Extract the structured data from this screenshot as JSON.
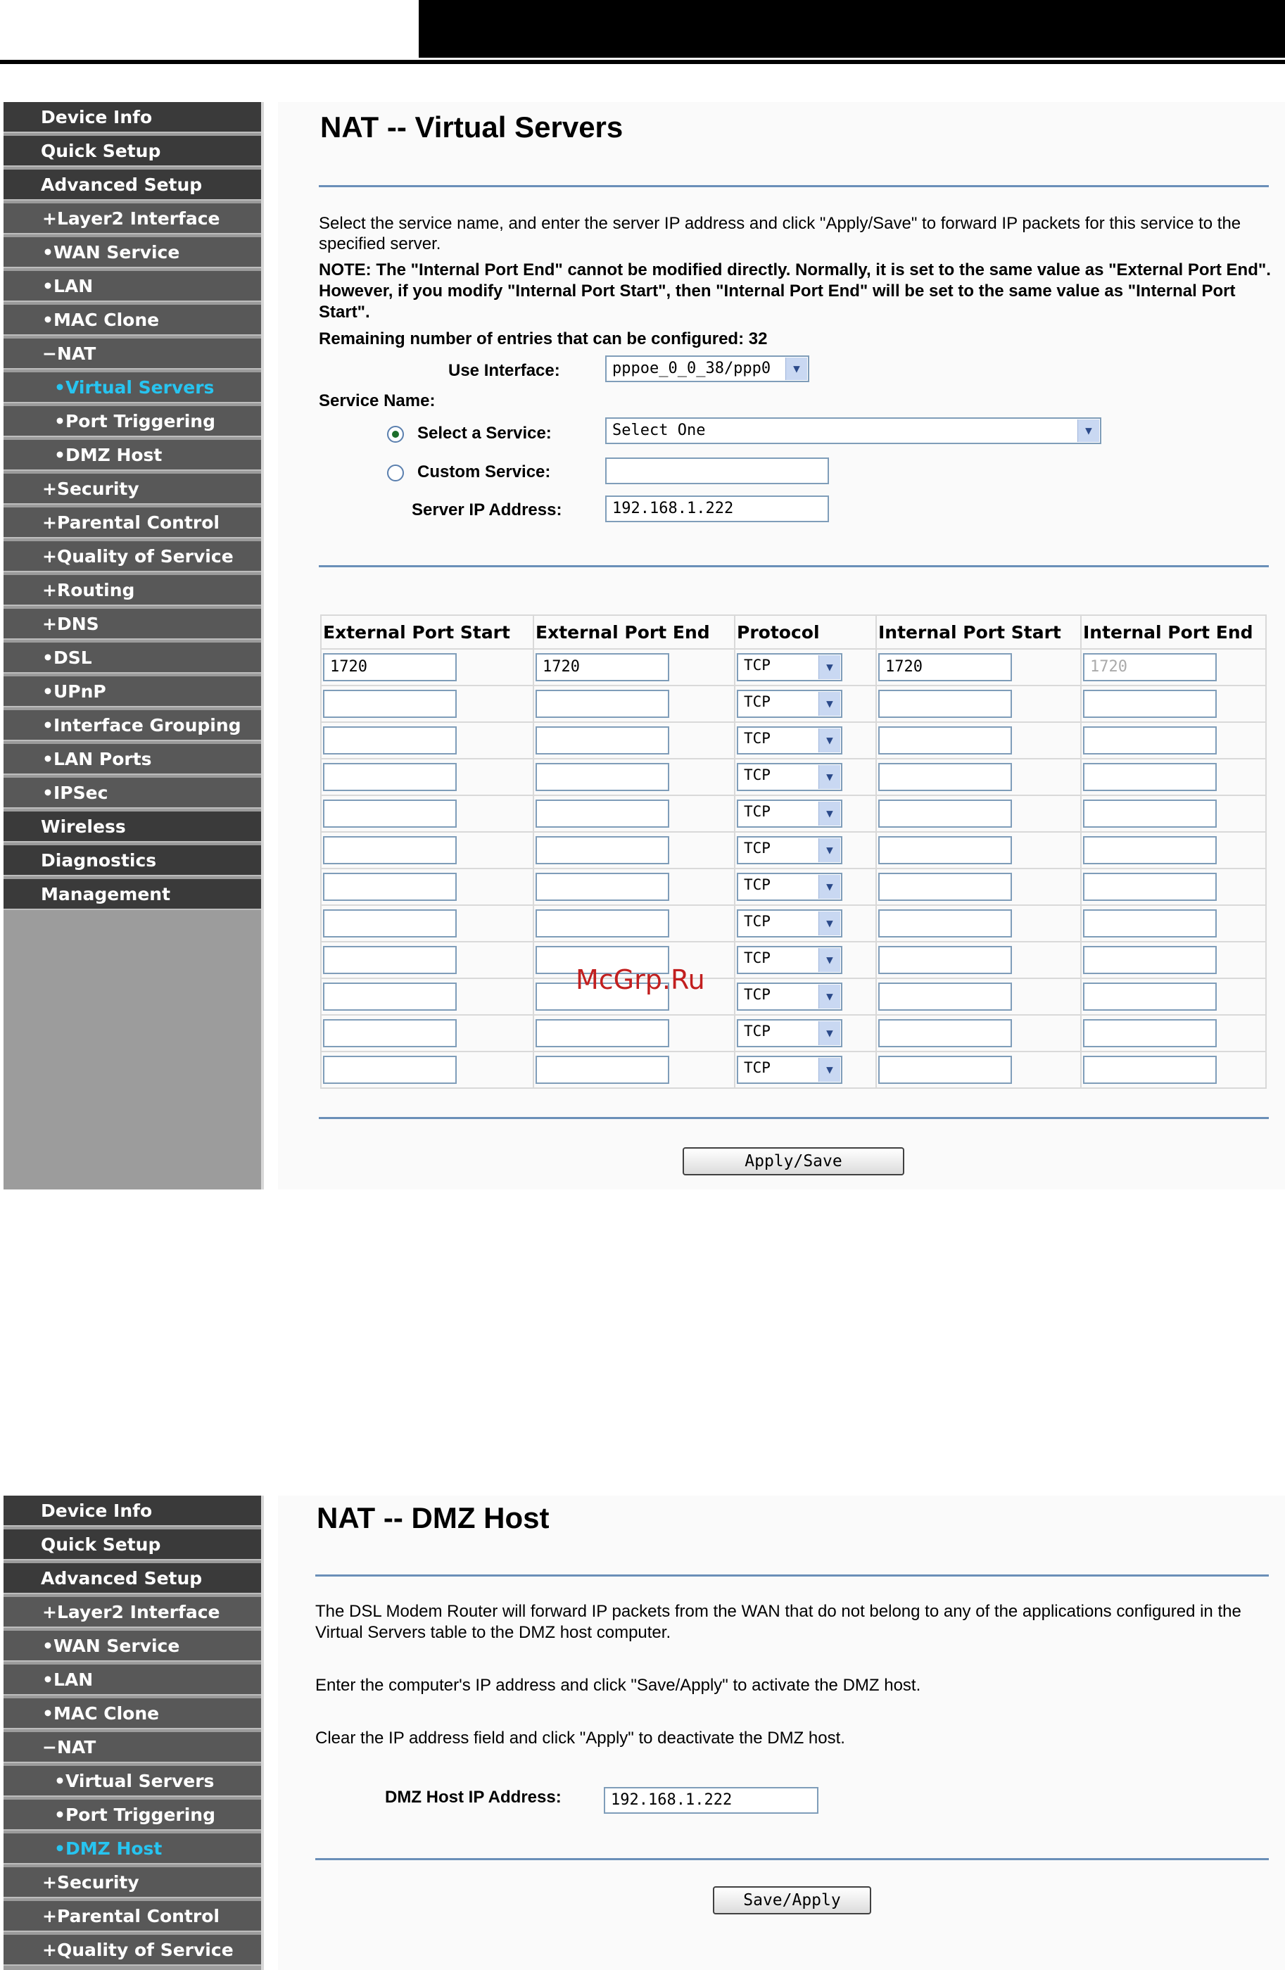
{
  "vs_page": {
    "menu": [
      {
        "label": "Device Info",
        "level": "top"
      },
      {
        "label": "Quick Setup",
        "level": "top"
      },
      {
        "label": "Advanced Setup",
        "level": "top"
      },
      {
        "label": "+Layer2 Interface",
        "level": "sub"
      },
      {
        "label": "•WAN Service",
        "level": "sub"
      },
      {
        "label": "•LAN",
        "level": "sub"
      },
      {
        "label": "•MAC Clone",
        "level": "sub"
      },
      {
        "label": "−NAT",
        "level": "sub"
      },
      {
        "label": "•Virtual Servers",
        "level": "sub2",
        "active": true
      },
      {
        "label": "•Port Triggering",
        "level": "sub2"
      },
      {
        "label": "•DMZ Host",
        "level": "sub2"
      },
      {
        "label": "+Security",
        "level": "sub"
      },
      {
        "label": "+Parental Control",
        "level": "sub"
      },
      {
        "label": "+Quality of Service",
        "level": "sub"
      },
      {
        "label": "+Routing",
        "level": "sub"
      },
      {
        "label": "+DNS",
        "level": "sub"
      },
      {
        "label": "•DSL",
        "level": "sub"
      },
      {
        "label": "•UPnP",
        "level": "sub"
      },
      {
        "label": "•Interface Grouping",
        "level": "sub"
      },
      {
        "label": "•LAN Ports",
        "level": "sub"
      },
      {
        "label": "•IPSec",
        "level": "sub"
      },
      {
        "label": "Wireless",
        "level": "top"
      },
      {
        "label": "Diagnostics",
        "level": "top"
      },
      {
        "label": "Management",
        "level": "top"
      }
    ],
    "title": "NAT -- Virtual Servers",
    "intro_line1": "Select the service name, and enter the server IP address and click \"Apply/Save\" to forward IP packets for this service to the",
    "intro_line2": "specified server.",
    "note_line1": "NOTE: The \"Internal Port End\" cannot be modified directly. Normally, it is set to the same value as \"External Port End\".",
    "note_line2": "However, if you modify \"Internal Port Start\", then \"Internal Port End\" will be set to the same value as \"Internal Port",
    "note_line3": "Start\".",
    "remaining": "Remaining number of entries that can be configured: 32",
    "use_interface_label": "Use Interface:",
    "use_interface_value": "pppoe_0_0_38/ppp0",
    "service_name_label": "Service Name:",
    "select_service_label": "Select a Service:",
    "select_service_value": "Select One",
    "custom_service_label": "Custom Service:",
    "custom_service_value": "",
    "server_ip_label": "Server IP Address:",
    "server_ip_value": "192.168.1.222",
    "table_headers": [
      "External Port Start",
      "External Port End",
      "Protocol",
      "Internal Port Start",
      "Internal Port End"
    ],
    "rows": [
      {
        "ext_start": "1720",
        "ext_end": "1720",
        "protocol": "TCP",
        "int_start": "1720",
        "int_end": "1720"
      },
      {
        "ext_start": "",
        "ext_end": "",
        "protocol": "TCP",
        "int_start": "",
        "int_end": ""
      },
      {
        "ext_start": "",
        "ext_end": "",
        "protocol": "TCP",
        "int_start": "",
        "int_end": ""
      },
      {
        "ext_start": "",
        "ext_end": "",
        "protocol": "TCP",
        "int_start": "",
        "int_end": ""
      },
      {
        "ext_start": "",
        "ext_end": "",
        "protocol": "TCP",
        "int_start": "",
        "int_end": ""
      },
      {
        "ext_start": "",
        "ext_end": "",
        "protocol": "TCP",
        "int_start": "",
        "int_end": ""
      },
      {
        "ext_start": "",
        "ext_end": "",
        "protocol": "TCP",
        "int_start": "",
        "int_end": ""
      },
      {
        "ext_start": "",
        "ext_end": "",
        "protocol": "TCP",
        "int_start": "",
        "int_end": ""
      },
      {
        "ext_start": "",
        "ext_end": "",
        "protocol": "TCP",
        "int_start": "",
        "int_end": ""
      },
      {
        "ext_start": "",
        "ext_end": "",
        "protocol": "TCP",
        "int_start": "",
        "int_end": ""
      },
      {
        "ext_start": "",
        "ext_end": "",
        "protocol": "TCP",
        "int_start": "",
        "int_end": ""
      },
      {
        "ext_start": "",
        "ext_end": "",
        "protocol": "TCP",
        "int_start": "",
        "int_end": ""
      }
    ],
    "apply_button": "Apply/Save",
    "watermark": "McGrp.Ru"
  },
  "dmz_page": {
    "menu": [
      {
        "label": "Device Info",
        "level": "top"
      },
      {
        "label": "Quick Setup",
        "level": "top"
      },
      {
        "label": "Advanced Setup",
        "level": "top"
      },
      {
        "label": "+Layer2 Interface",
        "level": "sub"
      },
      {
        "label": "•WAN Service",
        "level": "sub"
      },
      {
        "label": "•LAN",
        "level": "sub"
      },
      {
        "label": "•MAC Clone",
        "level": "sub"
      },
      {
        "label": "−NAT",
        "level": "sub"
      },
      {
        "label": "•Virtual Servers",
        "level": "sub2"
      },
      {
        "label": "•Port Triggering",
        "level": "sub2"
      },
      {
        "label": "•DMZ Host",
        "level": "sub2",
        "active": true
      },
      {
        "label": "+Security",
        "level": "sub"
      },
      {
        "label": "+Parental Control",
        "level": "sub"
      },
      {
        "label": "+Quality of Service",
        "level": "sub"
      }
    ],
    "title": "NAT -- DMZ Host",
    "para1_line1": "The DSL Modem Router will forward IP packets from the WAN that do not belong to any of the applications configured in the",
    "para1_line2": "Virtual Servers table to the DMZ host computer.",
    "para2": "Enter the computer's IP address and click \"Save/Apply\" to activate the DMZ host.",
    "para3": "Clear the IP address field and click \"Apply\" to deactivate the DMZ host.",
    "dmz_ip_label": "DMZ Host IP Address:",
    "dmz_ip_value": "192.168.1.222",
    "save_button": "Save/Apply"
  },
  "colors": {
    "nav_dark": "#3a3a3a",
    "nav_sub": "#585858",
    "nav_active": "#27c4f0",
    "divider": "#6a8fb8"
  }
}
